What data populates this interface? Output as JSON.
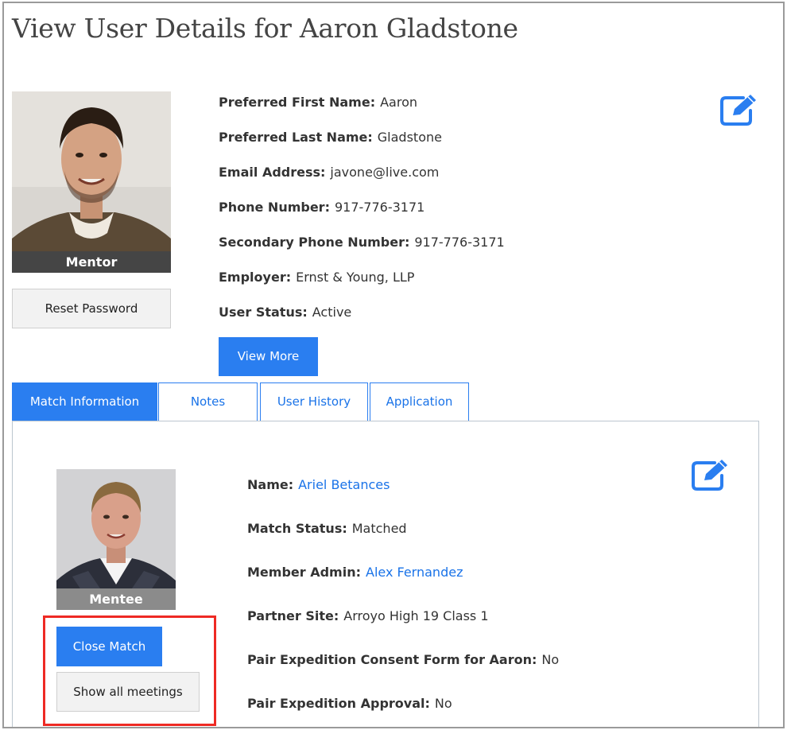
{
  "page": {
    "title": "View User Details for Aaron Gladstone"
  },
  "mentor": {
    "role": "Mentor",
    "reset_password_label": "Reset Password",
    "view_more_label": "View More",
    "fields": [
      {
        "label": "Preferred First Name:",
        "value": "Aaron"
      },
      {
        "label": "Preferred Last Name:",
        "value": "Gladstone"
      },
      {
        "label": "Email Address:",
        "value": "javone@live.com"
      },
      {
        "label": "Phone Number:",
        "value": "917-776-3171"
      },
      {
        "label": "Secondary Phone Number:",
        "value": "917-776-3171"
      },
      {
        "label": "Employer:",
        "value": "Ernst & Young, LLP"
      },
      {
        "label": "User Status:",
        "value": "Active"
      }
    ]
  },
  "tabs": [
    {
      "label": "Match Information",
      "active": true
    },
    {
      "label": "Notes",
      "active": false
    },
    {
      "label": "User History",
      "active": false
    },
    {
      "label": "Application",
      "active": false
    }
  ],
  "match": {
    "role": "Mentee",
    "close_match_label": "Close Match",
    "show_meetings_label": "Show all meetings",
    "fields": [
      {
        "label": "Name:",
        "value": "Ariel Betances",
        "link": true
      },
      {
        "label": "Match Status:",
        "value": "Matched",
        "link": false
      },
      {
        "label": "Member Admin:",
        "value": "Alex Fernandez",
        "link": true
      },
      {
        "label": "Partner Site:",
        "value": "Arroyo High 19 Class 1",
        "link": false
      },
      {
        "label": "Pair Expedition Consent Form for Aaron:",
        "value": "No",
        "link": false
      },
      {
        "label": "Pair Expedition Approval:",
        "value": "No",
        "link": false
      }
    ]
  },
  "icons": {
    "edit": "edit-icon"
  },
  "colors": {
    "primary": "#2a7ef0",
    "link": "#1a73e8",
    "highlight": "#ee2a24"
  }
}
